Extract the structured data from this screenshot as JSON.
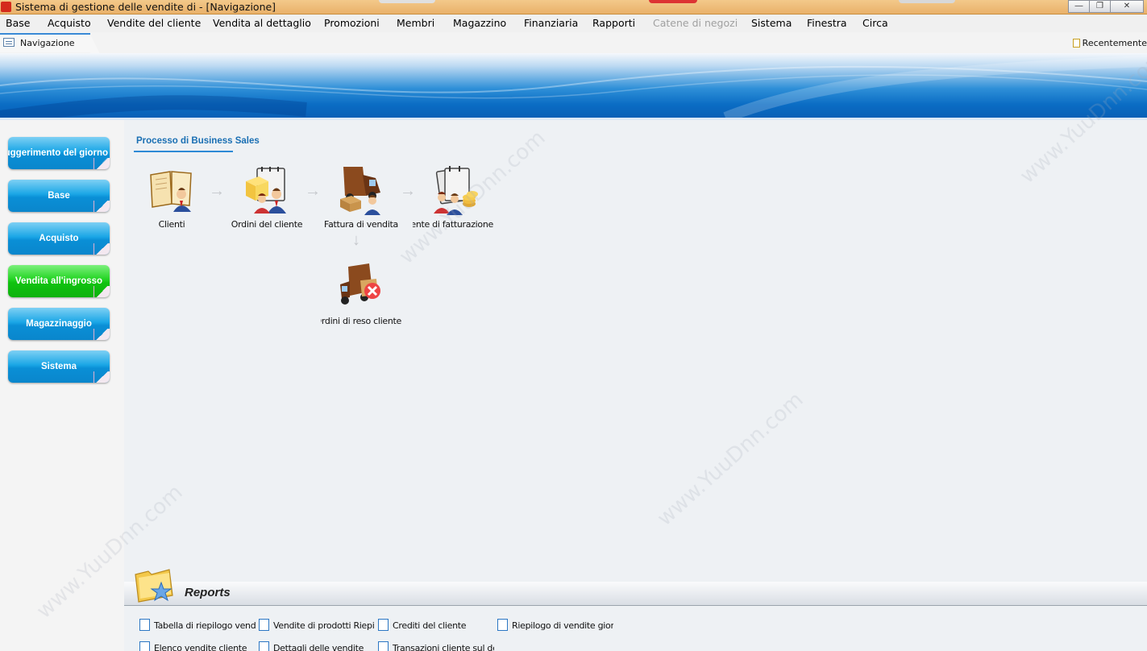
{
  "window": {
    "title": "Sistema di gestione delle vendite di  - [Navigazione]"
  },
  "menu": [
    {
      "label": "Base",
      "disabled": false
    },
    {
      "label": "Acquisto",
      "disabled": false
    },
    {
      "label": "Vendite del cliente",
      "disabled": false
    },
    {
      "label": "Vendita al dettaglio",
      "disabled": false
    },
    {
      "label": "Promozioni",
      "disabled": false
    },
    {
      "label": "Membri",
      "disabled": false
    },
    {
      "label": "Magazzino",
      "disabled": false
    },
    {
      "label": "Finanziaria",
      "disabled": false
    },
    {
      "label": "Rapporti",
      "disabled": false
    },
    {
      "label": "Catene di negozi",
      "disabled": true
    },
    {
      "label": "Sistema",
      "disabled": false
    },
    {
      "label": "Finestra",
      "disabled": false
    },
    {
      "label": "Circa",
      "disabled": false
    }
  ],
  "tabs": {
    "active": "Navigazione",
    "recent": "Recentemente"
  },
  "sidebar": {
    "items": [
      {
        "label": "Suggerimento del giorno",
        "active": false
      },
      {
        "label": "Base",
        "active": false
      },
      {
        "label": "Acquisto",
        "active": false
      },
      {
        "label": "Vendita all'ingrosso",
        "active": true
      },
      {
        "label": "Magazzinaggio",
        "active": false
      },
      {
        "label": "Sistema",
        "active": false
      }
    ]
  },
  "process": {
    "title": "Processo di Business Sales",
    "steps": [
      {
        "label": "Clienti",
        "icon": "customers-book-icon"
      },
      {
        "label": "Ordini del cliente",
        "icon": "customer-orders-icon"
      },
      {
        "label": "Fattura di vendita",
        "icon": "sales-invoice-truck-icon"
      },
      {
        "label": "Cliente di fatturazione",
        "icon": "billing-client-icon"
      },
      {
        "label": "Ordini di reso cliente",
        "icon": "return-orders-truck-icon"
      }
    ]
  },
  "reports": {
    "title": "Reports",
    "links": [
      "Tabella di riepilogo vendite",
      "Vendite di prodotti Riepilogo",
      "Crediti del cliente",
      "Riepilogo di vendite giornaliere",
      "Elenco vendite cliente",
      "Dettagli delle vendite",
      "Transazioni cliente sul dettaglio"
    ]
  },
  "watermark": "www.YuuDnn.com",
  "colors": {
    "accent": "#1a6fb3",
    "nav_button": "#0a8fd6",
    "nav_button_active": "#10c210",
    "titlebar": "#e9b16a"
  }
}
